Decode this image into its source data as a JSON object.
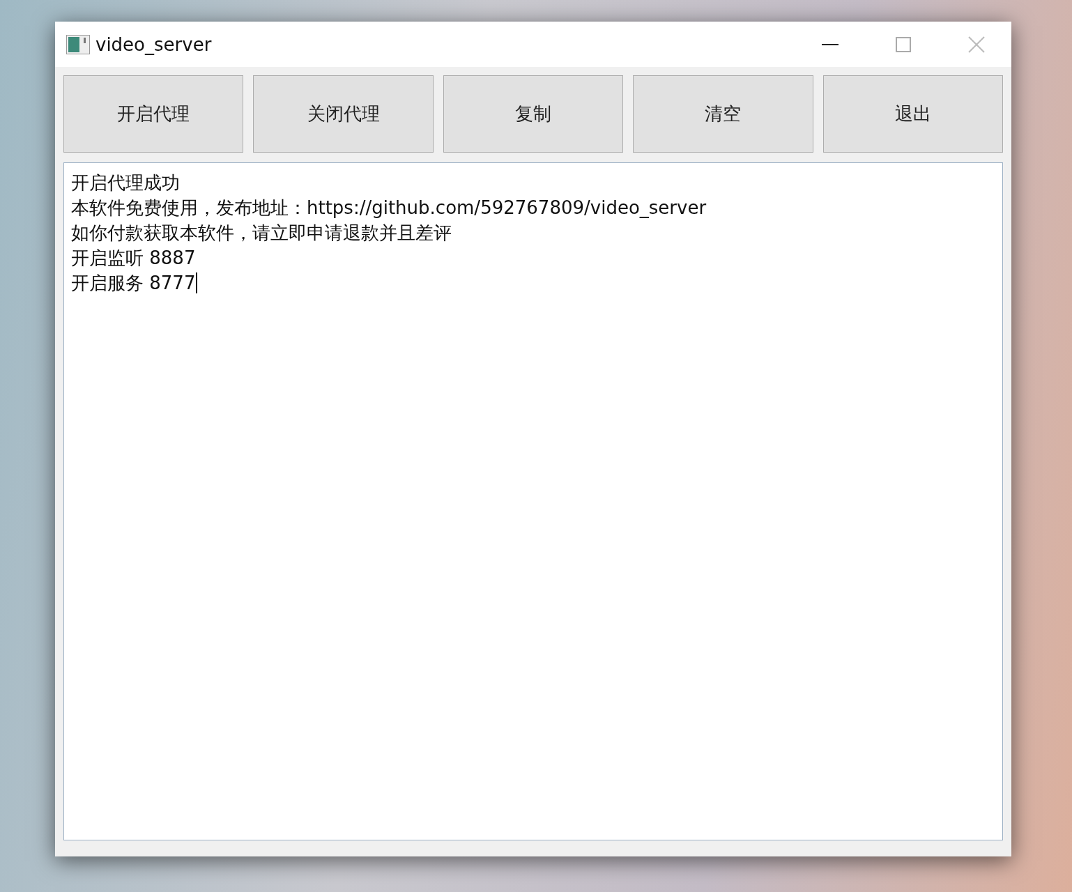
{
  "window": {
    "title": "video_server"
  },
  "buttons": [
    "开启代理",
    "关闭代理",
    "复制",
    "清空",
    "退出"
  ],
  "log": {
    "lines": [
      "开启代理成功",
      "本软件免费使用，发布地址：https://github.com/592767809/video_server",
      "如你付款获取本软件，请立即申请退款并且差评",
      "开启监听 8887",
      "开启服务 8777"
    ]
  }
}
